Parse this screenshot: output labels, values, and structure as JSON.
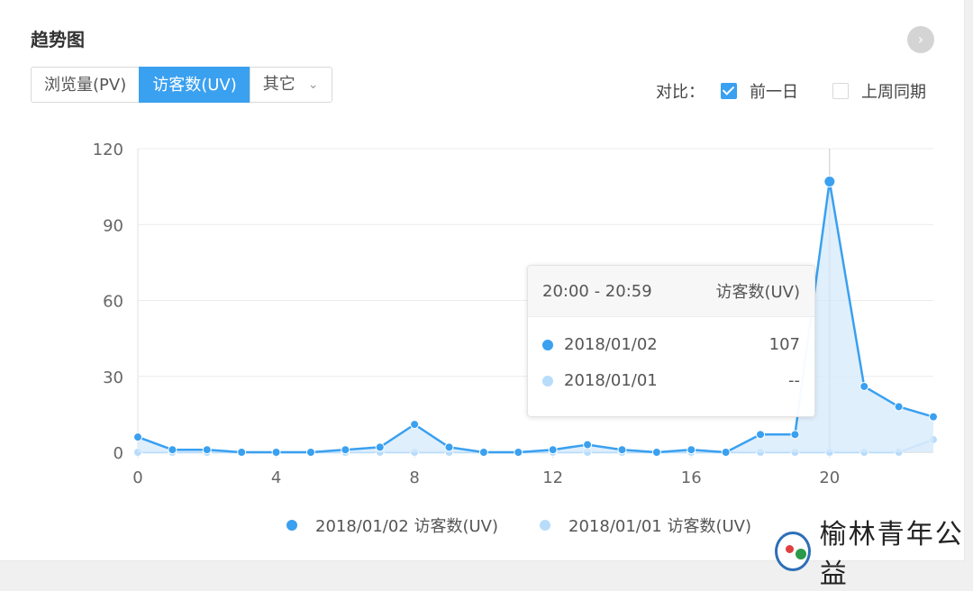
{
  "header": {
    "title": "趋势图",
    "next_icon": "chevron-right-icon"
  },
  "tabs": [
    {
      "label": "浏览量(PV)",
      "active": false
    },
    {
      "label": "访客数(UV)",
      "active": true
    },
    {
      "label": "其它",
      "active": false,
      "dropdown": true
    }
  ],
  "compare": {
    "label": "对比：",
    "options": [
      {
        "label": "前一日",
        "checked": true
      },
      {
        "label": "上周同期",
        "checked": false
      }
    ]
  },
  "colors": {
    "primary": "#3aa0f0",
    "secondary": "#b8dcfb",
    "fill": "#d6eafb"
  },
  "tooltip": {
    "time_range": "20:00 - 20:59",
    "metric": "访客数(UV)",
    "rows": [
      {
        "label": "2018/01/02",
        "value": "107"
      },
      {
        "label": "2018/01/01",
        "value": "--"
      }
    ]
  },
  "chart_data": {
    "type": "line",
    "x": [
      0,
      1,
      2,
      3,
      4,
      5,
      6,
      7,
      8,
      9,
      10,
      11,
      12,
      13,
      14,
      15,
      16,
      17,
      18,
      19,
      20,
      21,
      22,
      23
    ],
    "x_ticks": [
      0,
      4,
      8,
      12,
      16,
      20
    ],
    "ylim": [
      0,
      120
    ],
    "y_ticks": [
      0,
      30,
      60,
      90,
      120
    ],
    "grid": true,
    "series": [
      {
        "name": "2018/01/02 访客数(UV)",
        "values": [
          6,
          1,
          1,
          0,
          0,
          0,
          1,
          2,
          11,
          2,
          0,
          0,
          1,
          3,
          1,
          0,
          1,
          0,
          7,
          7,
          107,
          26,
          18,
          14
        ]
      },
      {
        "name": "2018/01/01 访客数(UV)",
        "values": [
          0,
          0,
          0,
          0,
          0,
          0,
          0,
          0,
          0,
          0,
          0,
          0,
          0,
          0,
          0,
          0,
          0,
          0,
          0,
          0,
          0,
          0,
          0,
          5
        ]
      }
    ],
    "highlight_x": 20
  },
  "watermark": {
    "text": "榆林青年公益"
  }
}
